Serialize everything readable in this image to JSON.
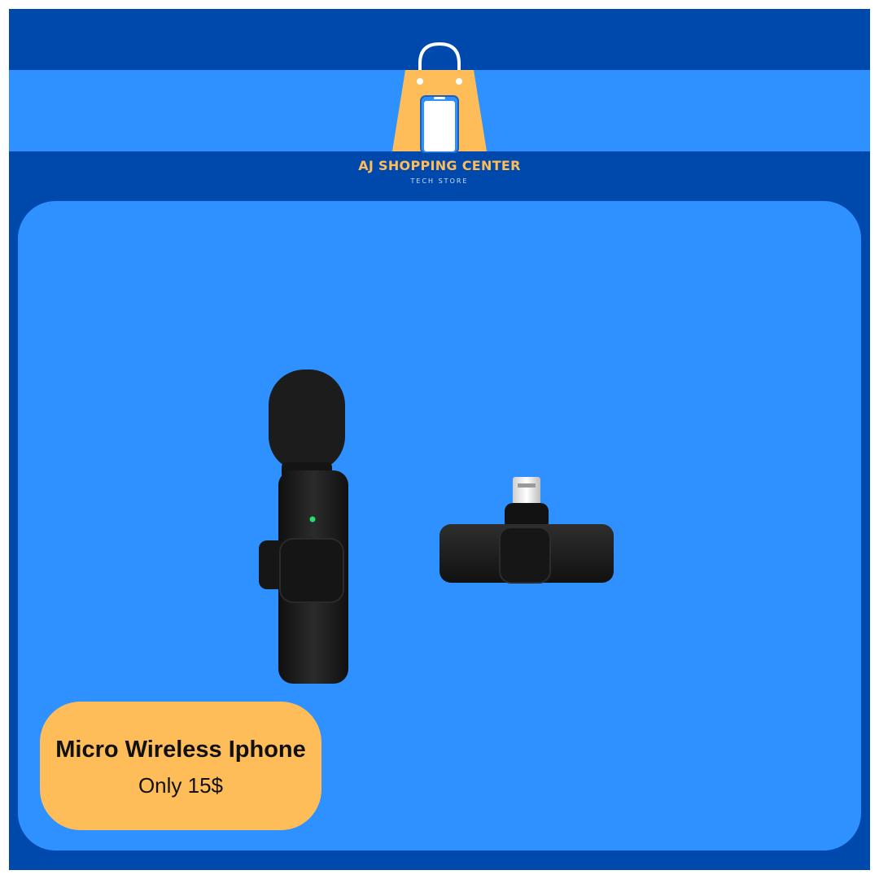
{
  "brand": {
    "name": "AJ SHOPPING CENTER",
    "tagline": "TECH STORE",
    "logo_icon": "shopping-bag-phone-icon"
  },
  "product": {
    "image_icon": "wireless-lavalier-microphone-and-lightning-receiver",
    "title": "Micro Wireless Iphone",
    "price_text": "Only 15$"
  },
  "colors": {
    "frame": "#0049ac",
    "band": "#2f91ff",
    "panel": "#2f91ff",
    "accent": "#ffbd59",
    "brand_text": "#ffbd59",
    "tagline_text": "#cfe0f7",
    "device": "#1a1a1a"
  }
}
